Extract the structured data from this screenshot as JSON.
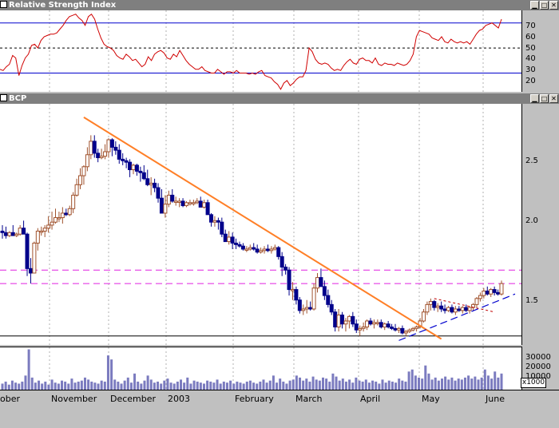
{
  "rsi_panel": {
    "title": "Relative Strength Index",
    "ticks": [
      "70",
      "60",
      "50",
      "40",
      "30",
      "20"
    ]
  },
  "price_panel": {
    "title": "BCP",
    "ticks": [
      "2.5",
      "2.0",
      "1.5"
    ]
  },
  "volume_panel": {
    "ticks": [
      "30000",
      "20000",
      "10000"
    ],
    "unit": "x1000"
  },
  "months": [
    "ober",
    "November",
    "December",
    "2003",
    "February",
    "March",
    "April",
    "May",
    "June"
  ],
  "chart_data": [
    {
      "type": "line",
      "title": "Relative Strength Index",
      "ylim": [
        15,
        80
      ],
      "reference_levels": [
        70,
        50,
        30
      ],
      "series": [
        {
          "values": [
            33,
            32,
            35,
            37,
            44,
            42,
            28,
            36,
            42,
            45,
            52,
            53,
            50,
            56,
            59,
            60,
            61,
            61,
            62,
            65,
            68,
            72,
            75,
            76,
            77,
            74,
            72,
            68,
            75,
            77,
            73,
            65,
            58,
            53,
            51,
            50,
            48,
            44,
            42,
            41,
            45,
            43,
            40,
            41,
            38,
            35,
            37,
            43,
            40,
            45,
            47,
            48,
            46,
            42,
            41,
            45,
            43,
            48,
            44,
            40,
            37,
            35,
            33,
            33,
            35,
            32,
            31,
            30,
            30,
            33,
            31,
            29,
            31,
            31,
            30,
            32,
            30,
            30,
            30,
            29,
            30,
            29,
            31,
            32,
            28,
            27,
            26,
            23,
            21,
            17,
            22,
            24,
            20,
            22,
            25,
            27,
            27,
            32,
            50,
            47,
            41,
            38,
            37,
            38,
            37,
            34,
            32,
            33,
            32,
            36,
            39,
            41,
            38,
            37,
            41,
            42,
            40,
            40,
            38,
            42,
            37,
            36,
            38,
            37,
            37,
            36,
            38,
            37,
            36,
            37,
            40,
            45,
            59,
            64,
            63,
            62,
            61,
            58,
            57,
            56,
            59,
            55,
            54,
            57,
            55,
            54,
            55,
            54,
            55,
            53,
            57,
            61,
            64,
            65,
            68,
            69,
            70,
            68,
            66,
            73
          ]
        }
      ]
    },
    {
      "type": "candlestick",
      "title": "BCP",
      "ylim": [
        1.13,
        2.74
      ],
      "x_labels": [
        "ober",
        "November",
        "December",
        "2003",
        "February",
        "March",
        "April",
        "May",
        "June"
      ],
      "colors": {
        "up": "#a0522d",
        "down": "#00008b",
        "trendline": "#ff7f27",
        "support": "#0000cd",
        "levels": "#e020e0"
      },
      "horizontal_levels": [
        1.63,
        1.54,
        1.19
      ],
      "ohlc": [
        [
          1.89,
          1.93,
          1.84,
          1.88
        ],
        [
          1.88,
          1.92,
          1.84,
          1.86
        ],
        [
          1.86,
          1.89,
          1.85,
          1.88
        ],
        [
          1.88,
          1.93,
          1.86,
          1.86
        ],
        [
          1.86,
          1.88,
          1.85,
          1.87
        ],
        [
          1.87,
          1.93,
          1.86,
          1.91
        ],
        [
          1.91,
          1.96,
          1.87,
          1.87
        ],
        [
          1.87,
          1.88,
          1.59,
          1.64
        ],
        [
          1.64,
          1.71,
          1.54,
          1.61
        ],
        [
          1.61,
          1.82,
          1.62,
          1.81
        ],
        [
          1.81,
          1.91,
          1.76,
          1.89
        ],
        [
          1.89,
          1.92,
          1.86,
          1.89
        ],
        [
          1.89,
          1.93,
          1.85,
          1.91
        ],
        [
          1.91,
          1.99,
          1.88,
          1.93
        ],
        [
          1.93,
          2.02,
          1.9,
          1.95
        ],
        [
          1.95,
          2.04,
          1.94,
          1.98
        ],
        [
          1.98,
          2.02,
          1.95,
          1.98
        ],
        [
          1.98,
          2.05,
          1.94,
          2.01
        ],
        [
          2.01,
          2.04,
          1.99,
          2.0
        ],
        [
          2.0,
          2.06,
          1.99,
          2.04
        ],
        [
          2.04,
          2.15,
          2.01,
          2.13
        ],
        [
          2.13,
          2.24,
          2.12,
          2.2
        ],
        [
          2.2,
          2.31,
          2.17,
          2.26
        ],
        [
          2.26,
          2.33,
          2.2,
          2.32
        ],
        [
          2.32,
          2.45,
          2.29,
          2.4
        ],
        [
          2.4,
          2.53,
          2.37,
          2.49
        ],
        [
          2.49,
          2.53,
          2.38,
          2.41
        ],
        [
          2.41,
          2.44,
          2.35,
          2.38
        ],
        [
          2.38,
          2.44,
          2.37,
          2.39
        ],
        [
          2.39,
          2.47,
          2.37,
          2.42
        ],
        [
          2.42,
          2.51,
          2.38,
          2.5
        ],
        [
          2.5,
          2.51,
          2.39,
          2.45
        ],
        [
          2.45,
          2.49,
          2.4,
          2.43
        ],
        [
          2.43,
          2.47,
          2.34,
          2.37
        ],
        [
          2.37,
          2.41,
          2.33,
          2.36
        ],
        [
          2.36,
          2.38,
          2.31,
          2.35
        ],
        [
          2.35,
          2.37,
          2.25,
          2.3
        ],
        [
          2.3,
          2.34,
          2.27,
          2.33
        ],
        [
          2.33,
          2.34,
          2.26,
          2.29
        ],
        [
          2.29,
          2.32,
          2.22,
          2.28
        ],
        [
          2.28,
          2.33,
          2.23,
          2.24
        ],
        [
          2.24,
          2.3,
          2.19,
          2.2
        ],
        [
          2.2,
          2.25,
          2.13,
          2.21
        ],
        [
          2.21,
          2.24,
          2.15,
          2.18
        ],
        [
          2.18,
          2.21,
          2.08,
          2.11
        ],
        [
          2.11,
          2.17,
          2.05,
          2.01
        ],
        [
          2.01,
          2.13,
          1.98,
          2.07
        ],
        [
          2.07,
          2.16,
          2.05,
          2.13
        ],
        [
          2.13,
          2.17,
          2.08,
          2.09
        ],
        [
          2.09,
          2.12,
          2.06,
          2.09
        ],
        [
          2.09,
          2.11,
          2.05,
          2.09
        ],
        [
          2.09,
          2.11,
          2.05,
          2.06
        ],
        [
          2.06,
          2.09,
          2.05,
          2.08
        ],
        [
          2.08,
          2.1,
          2.06,
          2.08
        ],
        [
          2.08,
          2.1,
          2.06,
          2.08
        ],
        [
          2.08,
          2.11,
          2.07,
          2.09
        ],
        [
          2.09,
          2.12,
          2.06,
          2.05
        ],
        [
          2.05,
          2.1,
          2.04,
          2.08
        ],
        [
          2.08,
          2.1,
          2.05,
          2.0
        ],
        [
          2.0,
          2.01,
          1.92,
          1.95
        ],
        [
          1.95,
          1.99,
          1.92,
          1.96
        ],
        [
          1.96,
          1.98,
          1.9,
          1.95
        ],
        [
          1.95,
          1.98,
          1.85,
          1.87
        ],
        [
          1.87,
          1.9,
          1.84,
          1.82
        ],
        [
          1.82,
          1.89,
          1.8,
          1.85
        ],
        [
          1.85,
          1.88,
          1.77,
          1.81
        ],
        [
          1.81,
          1.84,
          1.77,
          1.8
        ],
        [
          1.8,
          1.82,
          1.78,
          1.79
        ],
        [
          1.79,
          1.81,
          1.76,
          1.77
        ],
        [
          1.77,
          1.79,
          1.75,
          1.77
        ],
        [
          1.77,
          1.8,
          1.76,
          1.78
        ],
        [
          1.78,
          1.81,
          1.76,
          1.77
        ],
        [
          1.77,
          1.8,
          1.74,
          1.75
        ],
        [
          1.75,
          1.78,
          1.74,
          1.76
        ],
        [
          1.76,
          1.79,
          1.74,
          1.77
        ],
        [
          1.77,
          1.8,
          1.75,
          1.76
        ],
        [
          1.76,
          1.79,
          1.74,
          1.77
        ],
        [
          1.77,
          1.8,
          1.76,
          1.78
        ],
        [
          1.78,
          1.79,
          1.7,
          1.72
        ],
        [
          1.72,
          1.75,
          1.59,
          1.65
        ],
        [
          1.65,
          1.67,
          1.6,
          1.63
        ],
        [
          1.63,
          1.65,
          1.46,
          1.5
        ],
        [
          1.5,
          1.55,
          1.43,
          1.5
        ],
        [
          1.5,
          1.52,
          1.4,
          1.43
        ],
        [
          1.43,
          1.45,
          1.34,
          1.36
        ],
        [
          1.36,
          1.4,
          1.33,
          1.37
        ],
        [
          1.37,
          1.43,
          1.34,
          1.38
        ],
        [
          1.38,
          1.42,
          1.36,
          1.37
        ],
        [
          1.37,
          1.54,
          1.36,
          1.51
        ],
        [
          1.51,
          1.61,
          1.48,
          1.58
        ],
        [
          1.58,
          1.64,
          1.52,
          1.52
        ],
        [
          1.52,
          1.56,
          1.43,
          1.46
        ],
        [
          1.46,
          1.5,
          1.38,
          1.4
        ],
        [
          1.4,
          1.43,
          1.33,
          1.35
        ],
        [
          1.35,
          1.37,
          1.22,
          1.25
        ],
        [
          1.25,
          1.37,
          1.22,
          1.33
        ],
        [
          1.33,
          1.35,
          1.24,
          1.27
        ],
        [
          1.27,
          1.31,
          1.22,
          1.29
        ],
        [
          1.29,
          1.33,
          1.24,
          1.32
        ],
        [
          1.32,
          1.35,
          1.25,
          1.27
        ],
        [
          1.27,
          1.3,
          1.21,
          1.23
        ],
        [
          1.23,
          1.26,
          1.19,
          1.24
        ],
        [
          1.24,
          1.28,
          1.22,
          1.25
        ],
        [
          1.25,
          1.3,
          1.23,
          1.29
        ],
        [
          1.29,
          1.31,
          1.26,
          1.27
        ],
        [
          1.27,
          1.3,
          1.24,
          1.28
        ],
        [
          1.28,
          1.3,
          1.26,
          1.28
        ],
        [
          1.28,
          1.3,
          1.24,
          1.25
        ],
        [
          1.25,
          1.28,
          1.23,
          1.27
        ],
        [
          1.27,
          1.29,
          1.24,
          1.25
        ],
        [
          1.25,
          1.27,
          1.23,
          1.24
        ],
        [
          1.24,
          1.27,
          1.22,
          1.23
        ],
        [
          1.23,
          1.25,
          1.21,
          1.24
        ],
        [
          1.24,
          1.26,
          1.2,
          1.21
        ],
        [
          1.21,
          1.23,
          1.19,
          1.22
        ],
        [
          1.22,
          1.24,
          1.21,
          1.23
        ],
        [
          1.23,
          1.25,
          1.22,
          1.24
        ],
        [
          1.24,
          1.26,
          1.22,
          1.25
        ],
        [
          1.25,
          1.31,
          1.24,
          1.29
        ],
        [
          1.29,
          1.37,
          1.28,
          1.35
        ],
        [
          1.35,
          1.42,
          1.33,
          1.4
        ],
        [
          1.4,
          1.44,
          1.36,
          1.42
        ],
        [
          1.42,
          1.43,
          1.36,
          1.38
        ],
        [
          1.38,
          1.41,
          1.35,
          1.39
        ],
        [
          1.39,
          1.42,
          1.35,
          1.37
        ],
        [
          1.37,
          1.4,
          1.34,
          1.36
        ],
        [
          1.36,
          1.39,
          1.35,
          1.38
        ],
        [
          1.38,
          1.4,
          1.34,
          1.35
        ],
        [
          1.35,
          1.39,
          1.33,
          1.37
        ],
        [
          1.37,
          1.39,
          1.35,
          1.36
        ],
        [
          1.36,
          1.39,
          1.34,
          1.38
        ],
        [
          1.38,
          1.4,
          1.35,
          1.36
        ],
        [
          1.36,
          1.39,
          1.34,
          1.38
        ],
        [
          1.38,
          1.41,
          1.36,
          1.4
        ],
        [
          1.4,
          1.45,
          1.38,
          1.44
        ],
        [
          1.44,
          1.48,
          1.42,
          1.46
        ],
        [
          1.46,
          1.51,
          1.44,
          1.49
        ],
        [
          1.49,
          1.52,
          1.46,
          1.47
        ],
        [
          1.47,
          1.51,
          1.45,
          1.5
        ],
        [
          1.5,
          1.52,
          1.46,
          1.48
        ],
        [
          1.48,
          1.5,
          1.46,
          1.47
        ],
        [
          1.47,
          1.56,
          1.46,
          1.54
        ]
      ]
    },
    {
      "type": "bar",
      "title": "",
      "ylim": [
        0,
        42000
      ],
      "values": [
        6000,
        8000,
        5000,
        9000,
        7000,
        6000,
        8000,
        14000,
        40000,
        12000,
        7000,
        9000,
        6000,
        8000,
        5000,
        10000,
        7000,
        6000,
        9000,
        8000,
        6000,
        11000,
        7000,
        8000,
        9000,
        12000,
        10000,
        8000,
        7000,
        6000,
        9000,
        8000,
        34000,
        30000,
        10000,
        8000,
        6000,
        9000,
        12000,
        7000,
        16000,
        8000,
        6000,
        9000,
        14000,
        10000,
        7000,
        8000,
        6000,
        9000,
        11000,
        7000,
        6000,
        8000,
        10000,
        7000,
        12000,
        6000,
        9000,
        8000,
        7000,
        6000,
        9000,
        8000,
        7000,
        10000,
        6000,
        8000,
        7000,
        9000,
        6000,
        8000,
        7000,
        6000,
        8000,
        9000,
        7000,
        6000,
        8000,
        10000,
        7000,
        9000,
        14000,
        7000,
        11000,
        8000,
        6000,
        9000,
        10000,
        14000,
        12000,
        9000,
        11000,
        8000,
        13000,
        10000,
        9000,
        12000,
        11000,
        8000,
        16000,
        13000,
        9000,
        11000,
        8000,
        10000,
        7000,
        12000,
        9000,
        8000,
        10000,
        7000,
        9000,
        8000,
        6000,
        10000,
        7000,
        9000,
        8000,
        7000,
        11000,
        9000,
        8000,
        18000,
        20000,
        14000,
        12000,
        11000,
        24000,
        16000,
        10000,
        12000,
        9000,
        11000,
        13000,
        10000,
        12000,
        9000,
        11000,
        10000,
        12000,
        14000,
        11000,
        13000,
        10000,
        12000,
        20000,
        14000,
        11000,
        18000,
        12000,
        16000
      ]
    }
  ]
}
